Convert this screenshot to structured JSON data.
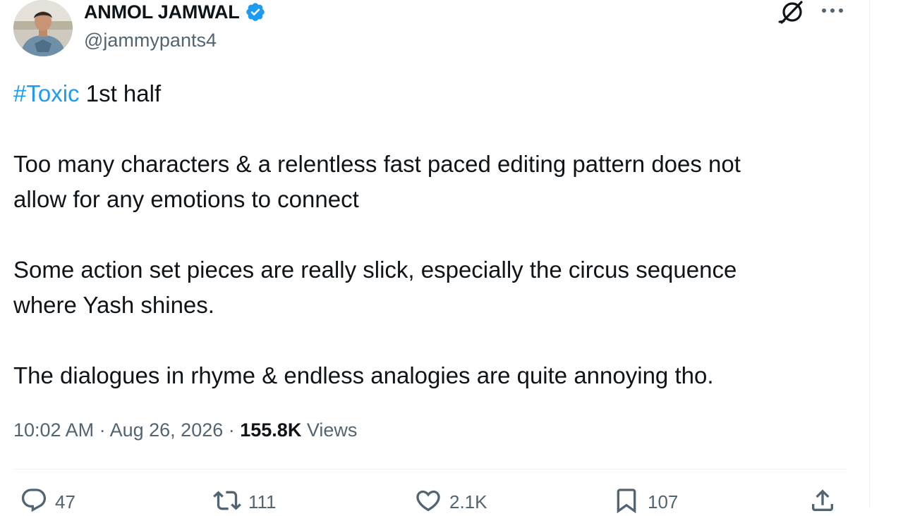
{
  "author": {
    "display_name": "ANMOL JAMWAL",
    "handle": "@jammypants4",
    "verified": true
  },
  "tweet": {
    "hashtag": "#Toxic",
    "first_line_rest": " 1st half",
    "lines": [
      "Too many characters & a relentless fast paced editing pattern does not",
      "allow for any emotions to connect",
      "Some action set pieces are really slick, especially the circus sequence",
      "where Yash shines.",
      "The dialogues in rhyme & endless analogies are quite annoying tho."
    ]
  },
  "meta": {
    "time": "10:02 AM",
    "separator": " · ",
    "date": "Aug 26, 2026",
    "views_count": "155.8K",
    "views_label": " Views"
  },
  "actions": {
    "reply_count": "47",
    "repost_count": "111",
    "like_count": "2.1K",
    "bookmark_count": "107"
  },
  "icons": {
    "verified": "verified-badge-icon",
    "grok": "grok-icon",
    "more": "more-options-icon",
    "reply": "reply-icon",
    "repost": "repost-icon",
    "like": "heart-icon",
    "bookmark": "bookmark-icon",
    "share": "share-icon"
  },
  "colors": {
    "hashtag": "#1d9bf0",
    "verified": "#1d9bf0",
    "text_primary": "#0f1419",
    "text_secondary": "#536471",
    "divider": "#eff3f4"
  }
}
